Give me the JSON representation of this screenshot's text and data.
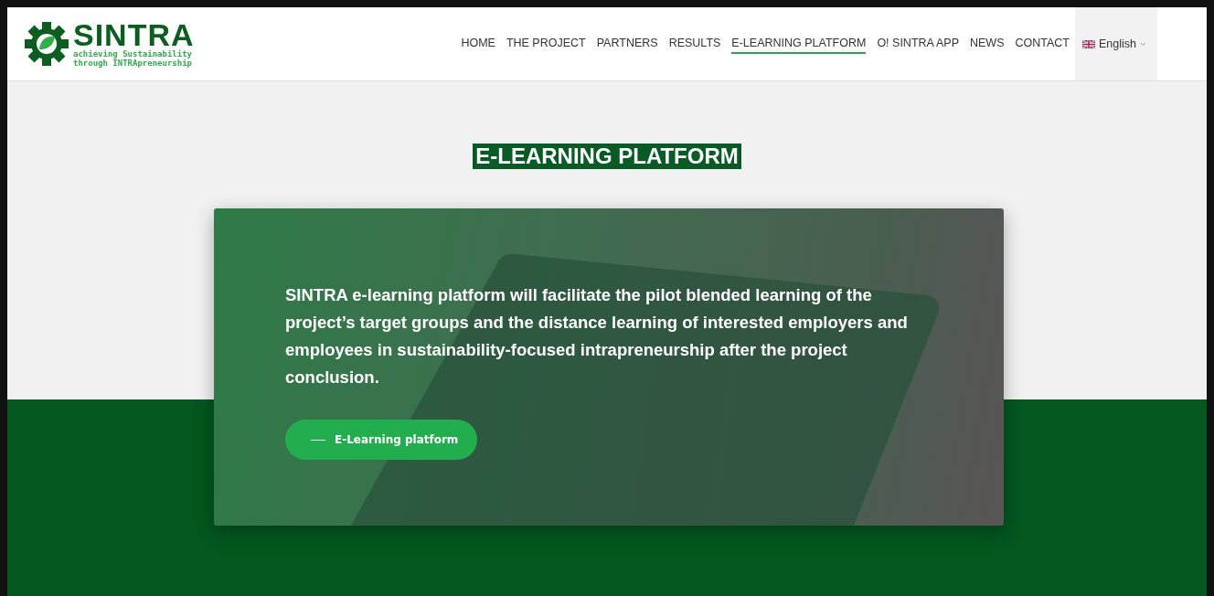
{
  "logo": {
    "name": "SINTRA",
    "tagline": [
      "achieving Sustainability",
      "through INTRApreneurship"
    ]
  },
  "nav": [
    {
      "label": "HOME",
      "selected": false
    },
    {
      "label": "THE PROJECT",
      "selected": false
    },
    {
      "label": "PARTNERS",
      "selected": false
    },
    {
      "label": "RESULTS",
      "selected": false
    },
    {
      "label": "E-LEARNING PLATFORM",
      "selected": true
    },
    {
      "label": "O! SINTRA APP",
      "selected": false
    },
    {
      "label": "NEWS",
      "selected": false
    },
    {
      "label": "CONTACT",
      "selected": false
    }
  ],
  "language": {
    "label": "English"
  },
  "page_title": "E-LEARNING PLATFORM",
  "hero": {
    "text": "SINTRA e-learning platform will facilitate the pilot blended learning of the project’s target groups and the distance learning of interested employers and employees in sustainability-focused intrapreneurship after the project conclusion.",
    "button": "E-Learning platform"
  }
}
